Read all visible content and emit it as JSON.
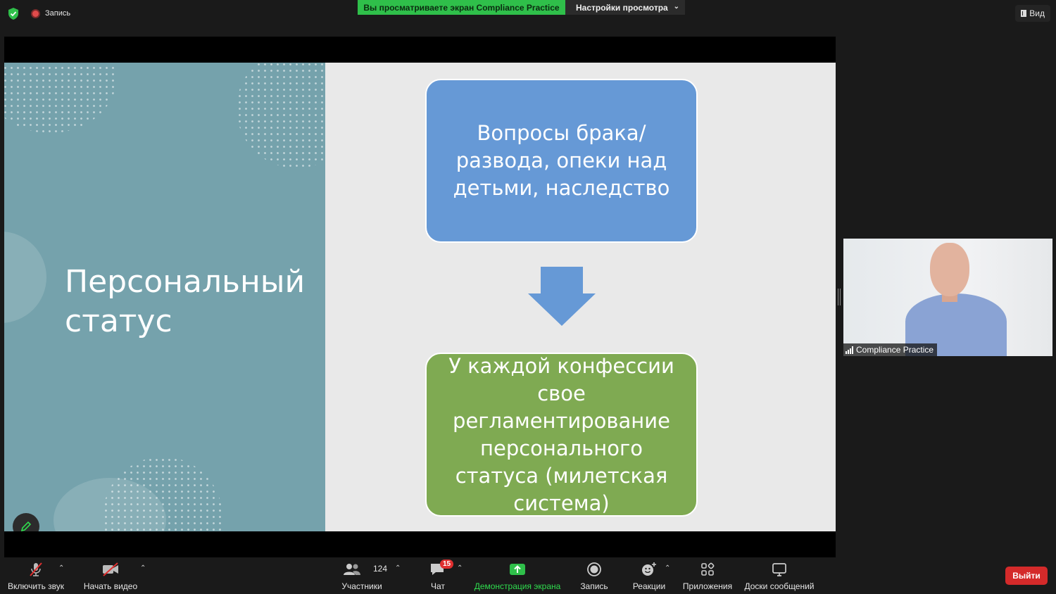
{
  "top": {
    "recording_label": "Запись",
    "share_banner": "Вы просматриваете экран Compliance Practice",
    "view_settings": "Настройки просмотра",
    "view_button": "Вид"
  },
  "slide": {
    "title_line1": "Персональный",
    "title_line2": "статус",
    "box1": "Вопросы брака/развода, опеки над детьми, наследство",
    "box2": "У каждой конфессии свое регламентирование персонального статуса (милетская система)"
  },
  "video": {
    "participant_name": "Compliance Practice"
  },
  "toolbar": {
    "mute_label": "Включить звук",
    "video_label": "Начать видео",
    "participants_label": "Участники",
    "participants_count": "124",
    "chat_label": "Чат",
    "chat_badge": "15",
    "share_label": "Демонстрация экрана",
    "record_label": "Запись",
    "reactions_label": "Реакции",
    "apps_label": "Приложения",
    "whiteboards_label": "Доски сообщений",
    "leave_label": "Выйти"
  },
  "colors": {
    "share_green": "#2fbf4a",
    "slide_teal": "#75a2ac",
    "box_blue": "#6699d6",
    "box_green": "#7faa52",
    "leave_red": "#d42a2a"
  }
}
